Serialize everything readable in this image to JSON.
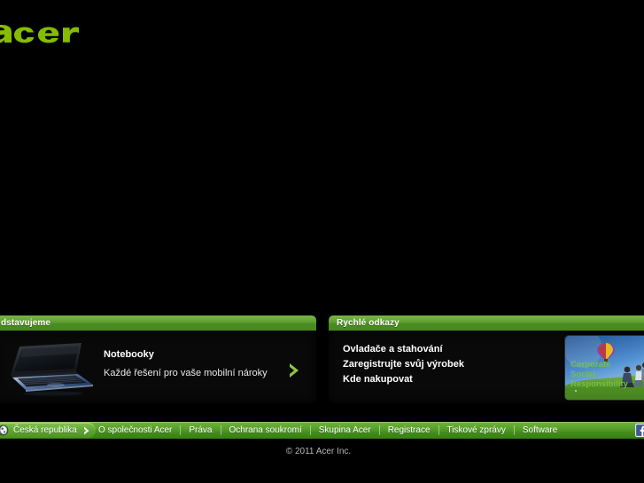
{
  "header": {
    "logo_text": "acer",
    "logo_icon": "acer-wordmark-logo"
  },
  "stage": {
    "note": ""
  },
  "panels": {
    "feature": {
      "header_title": "dstavujeme",
      "header_title_full": "Představujeme",
      "thumb_icon": "notebook-product-image",
      "title": "Notebooky",
      "subtitle": "Každé řešení pro vaše mobilní nároky",
      "arrow_icon": "chevron-right-icon"
    },
    "quick_links": {
      "header_title": "Rychlé odkazy",
      "items": [
        {
          "label": "Ovladače a stahování"
        },
        {
          "label": "Zaregistrujte svůj výrobek"
        },
        {
          "label": "Kde nakupovat"
        }
      ],
      "banner": {
        "icon": "corporate-social-responsibility-banner",
        "line1": "Corporate",
        "line2": "Social",
        "line3": "Responsibility"
      }
    }
  },
  "footer": {
    "region": {
      "icon": "globe-icon",
      "label": "Česká republika",
      "chevron_icon": "chevron-right-icon"
    },
    "links": [
      {
        "label": "O společnosti Acer"
      },
      {
        "label": "Práva"
      },
      {
        "label": "Ochrana soukromí"
      },
      {
        "label": "Skupina Acer"
      },
      {
        "label": "Registrace"
      },
      {
        "label": "Tiskové zprávy"
      },
      {
        "label": "Software"
      }
    ],
    "social": {
      "icon": "facebook-icon",
      "label": "f"
    },
    "copyright": "© 2011 Acer Inc."
  },
  "colors": {
    "brand_green": "#83b81a",
    "bar_green": "#57a02b",
    "header_green": "#5c9c2e",
    "background": "#000000",
    "panel": "#090909",
    "text": "#ffffff",
    "facebook_blue": "#3b5998"
  }
}
